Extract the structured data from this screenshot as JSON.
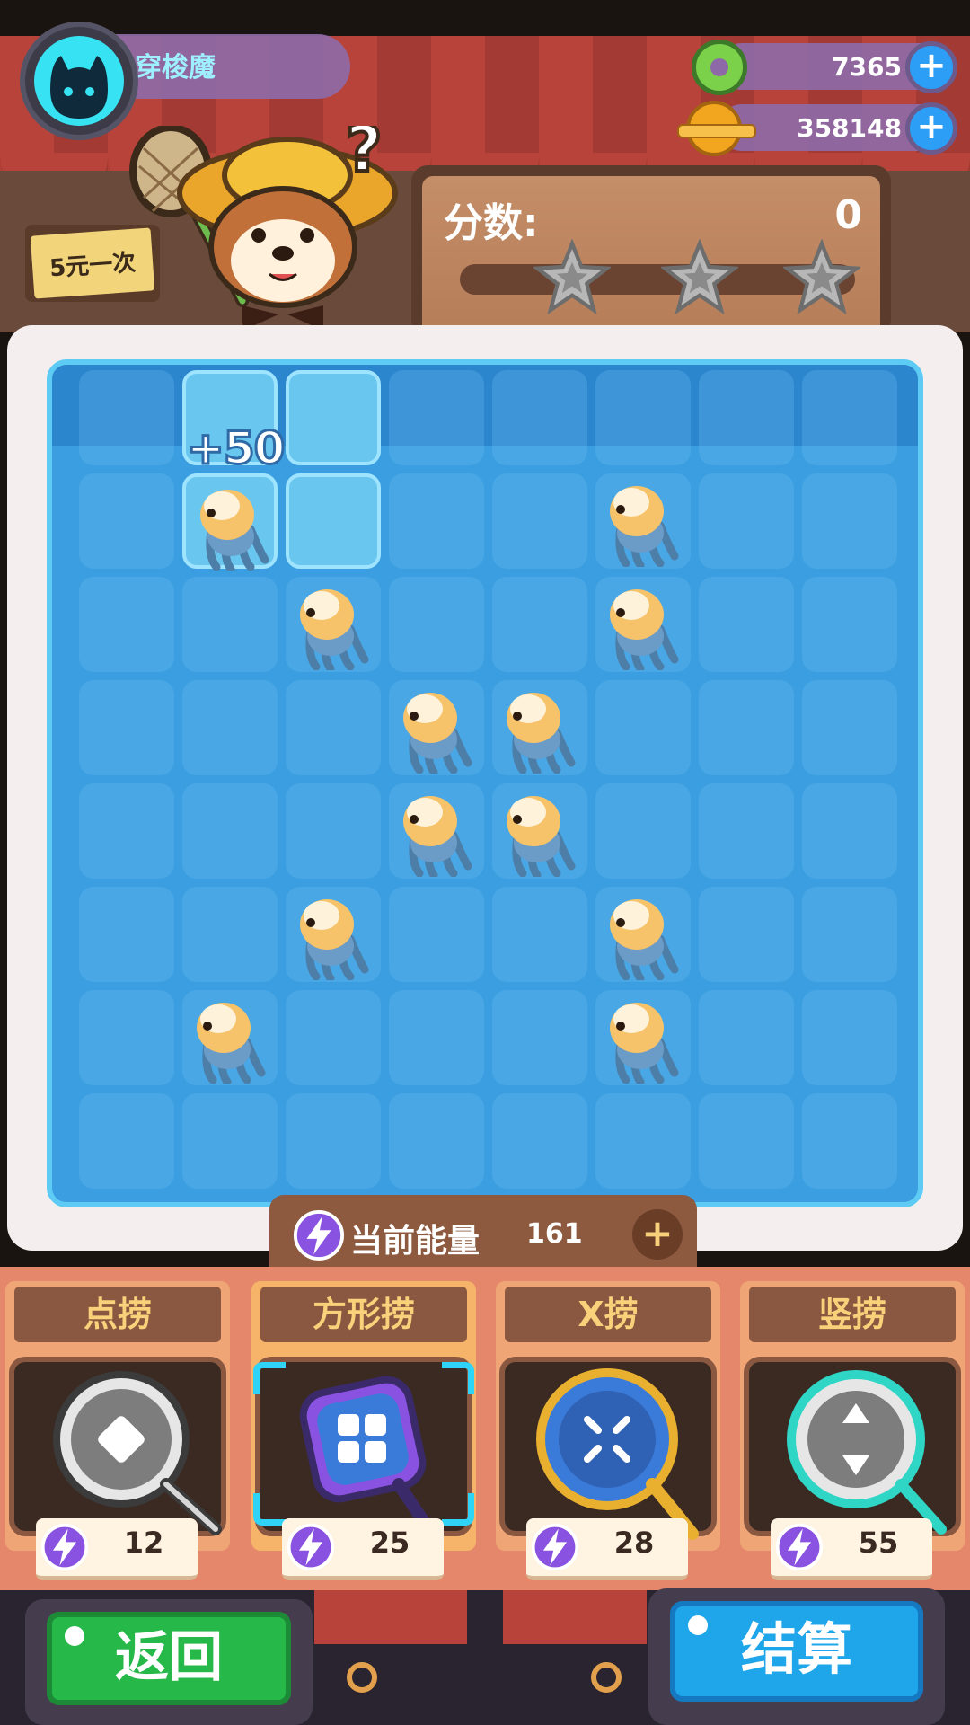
{
  "profile": {
    "name": "穿梭魔",
    "avatar_icon": "cat-face-icon"
  },
  "currencies": [
    {
      "name": "donut-gem-icon",
      "value": "7365",
      "color": "#7bd14a"
    },
    {
      "name": "gold-planet-coin-icon",
      "value": "358148",
      "color": "#f2a51e"
    }
  ],
  "shop_sign": "5元一次",
  "score": {
    "label": "分数:",
    "value": "0",
    "stars_earned": 0,
    "stars_total": 3
  },
  "board": {
    "rows": 8,
    "cols": 8,
    "float_text": "+50",
    "highlighted_cells": [
      [
        0,
        1
      ],
      [
        0,
        2
      ],
      [
        1,
        1
      ],
      [
        1,
        2
      ]
    ],
    "squids": [
      [
        1,
        1
      ],
      [
        1,
        5
      ],
      [
        2,
        2
      ],
      [
        2,
        5
      ],
      [
        3,
        3
      ],
      [
        3,
        4
      ],
      [
        4,
        3
      ],
      [
        4,
        4
      ],
      [
        5,
        2
      ],
      [
        5,
        5
      ],
      [
        6,
        1
      ],
      [
        6,
        5
      ]
    ]
  },
  "energy": {
    "label": "当前能量",
    "value": "161",
    "plus": "+"
  },
  "tools": [
    {
      "name": "点捞",
      "cost": "12",
      "icon": "dot-net-icon",
      "selected": false
    },
    {
      "name": "方形捞",
      "cost": "25",
      "icon": "square-net-icon",
      "selected": true
    },
    {
      "name": "X捞",
      "cost": "28",
      "icon": "x-net-icon",
      "selected": false
    },
    {
      "name": "竖捞",
      "cost": "55",
      "icon": "vertical-net-icon",
      "selected": false
    }
  ],
  "buttons": {
    "back": "返回",
    "settle": "结算"
  },
  "colors": {
    "water": "#3a9ee0",
    "back_button": "#27b84a",
    "settle_button": "#1fa6ea",
    "energy_purple": "#8a52e0"
  }
}
